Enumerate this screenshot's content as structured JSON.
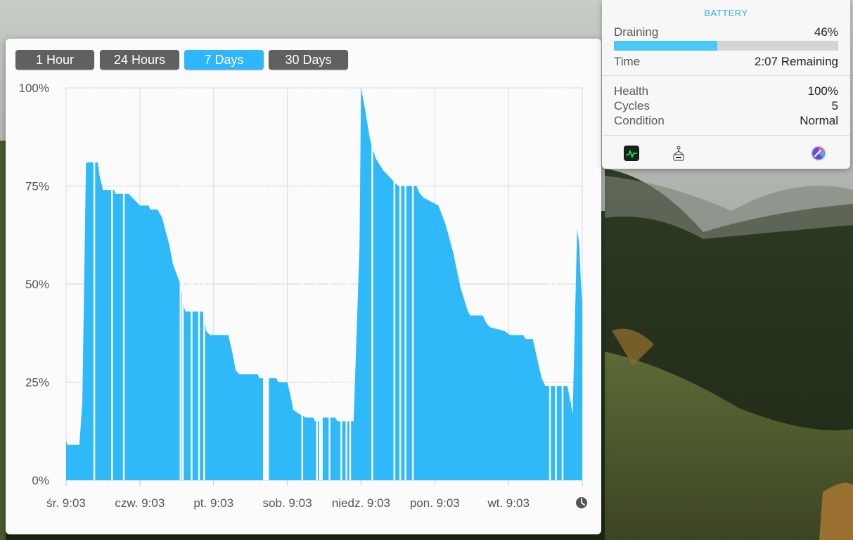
{
  "chart_window": {
    "range_buttons": [
      {
        "label": "1 Hour",
        "active": false
      },
      {
        "label": "24 Hours",
        "active": false
      },
      {
        "label": "7 Days",
        "active": true
      },
      {
        "label": "30 Days",
        "active": false
      }
    ]
  },
  "battery_panel": {
    "title": "BATTERY",
    "state_label": "Draining",
    "charge_percent_text": "46%",
    "charge_fraction": 0.46,
    "time_label": "Time",
    "time_value": "2:07 Remaining",
    "health_label": "Health",
    "health_value": "100%",
    "cycles_label": "Cycles",
    "cycles_value": "5",
    "condition_label": "Condition",
    "condition_value": "Normal",
    "footer_icons": [
      "activity-monitor-icon",
      "system-information-icon",
      "coconut-battery-icon"
    ]
  },
  "colors": {
    "accent": "#2eb7ff",
    "area_fill": "#2fb9f8",
    "button_inactive": "#606060",
    "panel_title": "#36a8e8"
  },
  "chart_data": {
    "type": "area",
    "ylim": [
      0,
      100
    ],
    "yticks": [
      "100%",
      "75%",
      "50%",
      "25%",
      "0%"
    ],
    "ytick_values": [
      100,
      75,
      50,
      25,
      0
    ],
    "xtick_labels": [
      "śr. 9:03",
      "czw. 9:03",
      "pt. 9:03",
      "sob. 9:03",
      "niedz. 9:03",
      "pon. 9:03",
      "wt. 9:03"
    ],
    "xlim_days": [
      0,
      7
    ],
    "grid": true,
    "series": [
      {
        "points": [
          [
            0.0,
            10
          ],
          [
            0.02,
            9
          ],
          [
            0.18,
            9
          ],
          [
            0.22,
            20
          ],
          [
            0.27,
            81
          ],
          [
            0.43,
            81
          ],
          [
            0.45,
            78
          ],
          [
            0.5,
            74
          ],
          [
            0.65,
            74
          ],
          [
            0.67,
            73
          ],
          [
            0.85,
            73
          ],
          [
            0.95,
            71
          ],
          [
            1.0,
            70
          ],
          [
            1.12,
            70
          ],
          [
            1.14,
            69
          ],
          [
            1.24,
            69
          ],
          [
            1.3,
            67
          ],
          [
            1.4,
            60
          ],
          [
            1.45,
            55
          ],
          [
            1.55,
            50
          ],
          [
            1.6,
            44
          ],
          [
            1.62,
            43
          ],
          [
            1.85,
            43
          ],
          [
            1.88,
            41
          ],
          [
            1.9,
            38
          ],
          [
            1.95,
            37
          ],
          [
            2.2,
            37
          ],
          [
            2.25,
            33
          ],
          [
            2.3,
            28
          ],
          [
            2.35,
            27
          ],
          [
            2.6,
            27
          ],
          [
            2.62,
            26
          ],
          [
            2.67,
            26
          ],
          [
            2.67,
            0
          ],
          [
            2.75,
            0
          ],
          [
            2.75,
            26
          ],
          [
            2.85,
            26
          ],
          [
            2.88,
            25
          ],
          [
            3.0,
            25
          ],
          [
            3.05,
            21
          ],
          [
            3.08,
            18
          ],
          [
            3.15,
            17
          ],
          [
            3.25,
            16
          ],
          [
            3.35,
            16
          ],
          [
            3.38,
            15
          ],
          [
            3.43,
            15
          ],
          [
            3.43,
            0
          ],
          [
            3.48,
            0
          ],
          [
            3.48,
            16
          ],
          [
            3.65,
            16
          ],
          [
            3.68,
            15
          ],
          [
            3.9,
            15
          ],
          [
            3.98,
            60
          ],
          [
            4.0,
            100
          ],
          [
            4.05,
            95
          ],
          [
            4.12,
            87
          ],
          [
            4.2,
            82
          ],
          [
            4.3,
            79
          ],
          [
            4.4,
            77
          ],
          [
            4.45,
            76
          ],
          [
            4.5,
            75
          ],
          [
            4.75,
            75
          ],
          [
            4.8,
            73
          ],
          [
            4.85,
            72
          ],
          [
            4.95,
            71
          ],
          [
            5.05,
            70
          ],
          [
            5.15,
            65
          ],
          [
            5.25,
            58
          ],
          [
            5.35,
            49
          ],
          [
            5.45,
            43
          ],
          [
            5.48,
            42
          ],
          [
            5.65,
            42
          ],
          [
            5.7,
            40
          ],
          [
            5.75,
            39
          ],
          [
            5.95,
            38
          ],
          [
            6.02,
            37
          ],
          [
            6.2,
            37
          ],
          [
            6.23,
            36
          ],
          [
            6.33,
            36
          ],
          [
            6.4,
            30
          ],
          [
            6.45,
            26
          ],
          [
            6.5,
            24
          ],
          [
            6.8,
            24
          ],
          [
            6.85,
            19
          ],
          [
            6.87,
            17
          ],
          [
            6.9,
            40
          ],
          [
            6.93,
            64
          ],
          [
            6.96,
            60
          ],
          [
            6.98,
            51
          ],
          [
            7.0,
            45
          ]
        ],
        "gaps": [
          0.38,
          0.62,
          0.78,
          1.55,
          1.58,
          1.7,
          1.8,
          1.87,
          2.68,
          3.2,
          3.4,
          3.57,
          3.73,
          3.8,
          3.85,
          4.15,
          4.45,
          4.53,
          4.6,
          4.7,
          6.56,
          6.64,
          6.73
        ]
      }
    ]
  }
}
